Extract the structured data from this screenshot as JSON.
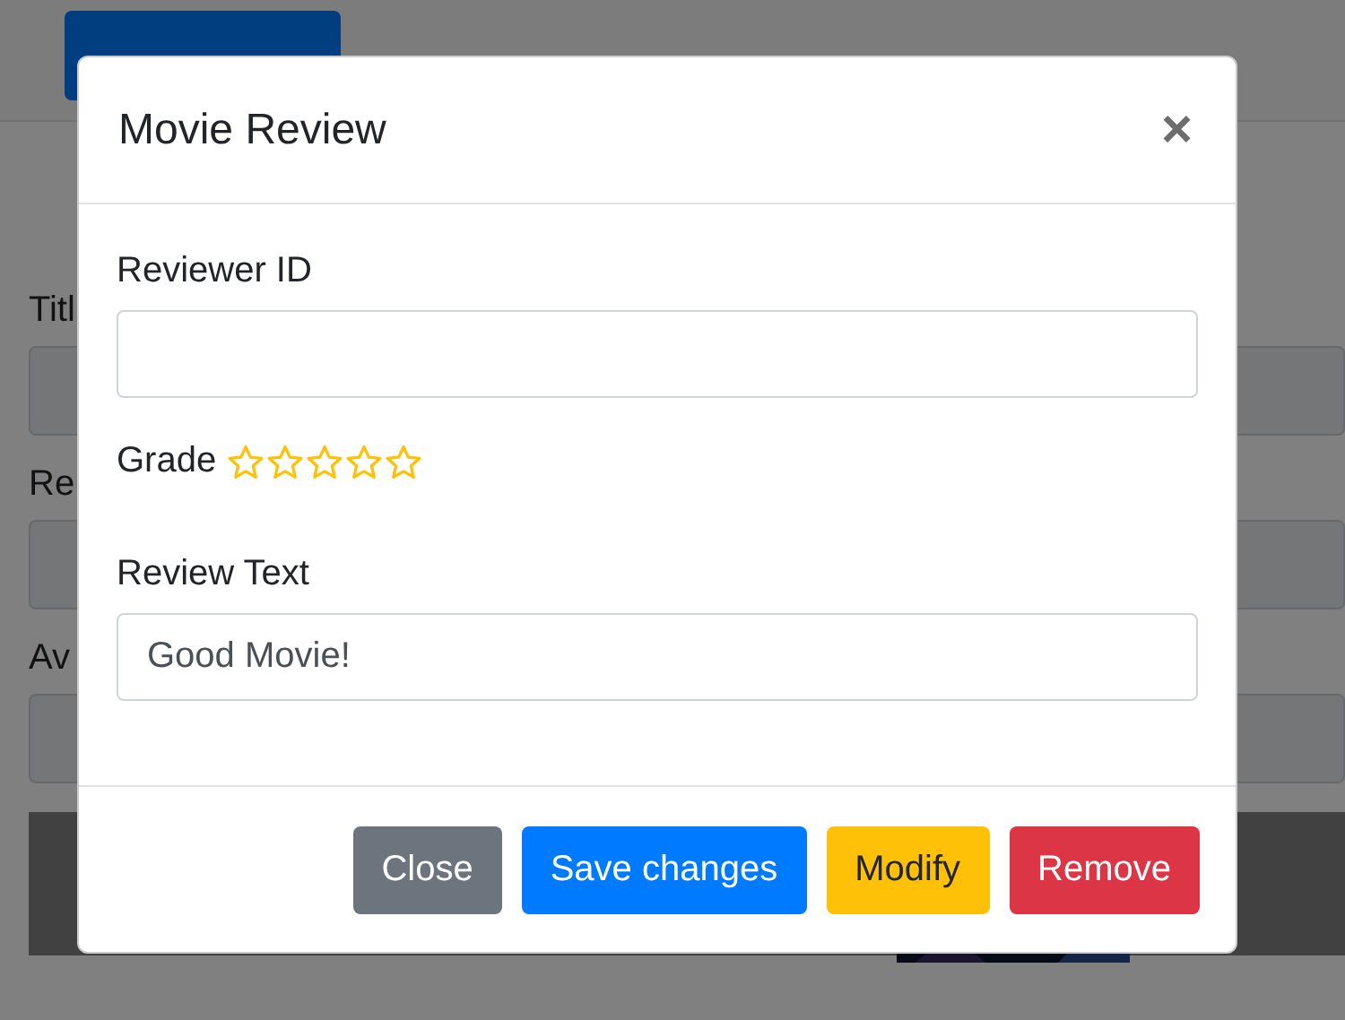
{
  "page": {
    "fields": [
      {
        "label": "Titl"
      },
      {
        "label": "Re"
      },
      {
        "label": "Av"
      }
    ]
  },
  "modal": {
    "title": "Movie Review",
    "close_icon": "×",
    "reviewer_id": {
      "label": "Reviewer ID"
    },
    "grade": {
      "label": "Grade",
      "stars": 0
    },
    "review_text": {
      "label": "Review Text",
      "value": "Good Movie!"
    },
    "buttons": [
      {
        "label": "Close",
        "kind": "secondary"
      },
      {
        "label": "Save changes",
        "kind": "primary"
      },
      {
        "label": "Modify",
        "kind": "warning"
      },
      {
        "label": "Remove",
        "kind": "danger"
      }
    ]
  }
}
